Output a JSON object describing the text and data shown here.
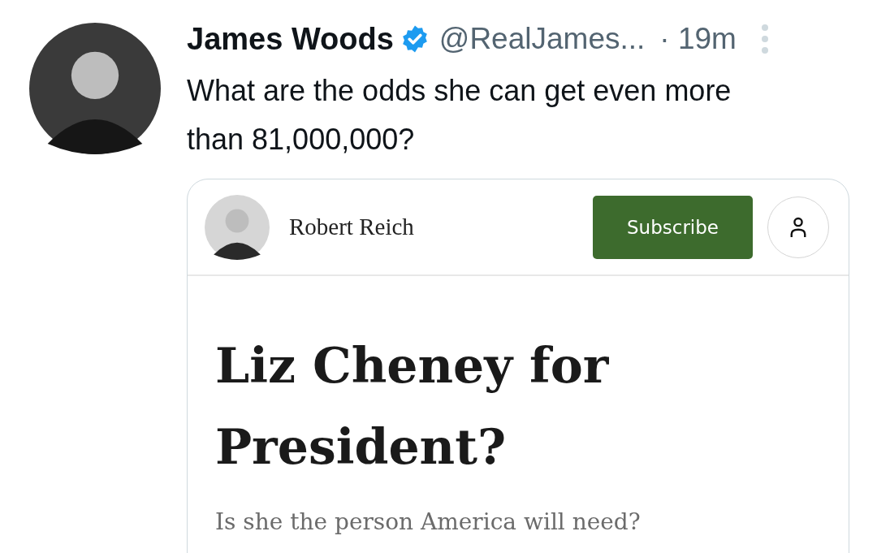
{
  "tweet": {
    "author": "James Woods",
    "verified": true,
    "handle": "@RealJames...",
    "time": "· 19m",
    "text": "What are the odds she can get even more than 81,000,000?",
    "card": {
      "author": "Robert Reich",
      "subscribe": "Subscribe",
      "title": "Liz Cheney for President?",
      "subtitle": "Is she the person America will need?"
    }
  }
}
